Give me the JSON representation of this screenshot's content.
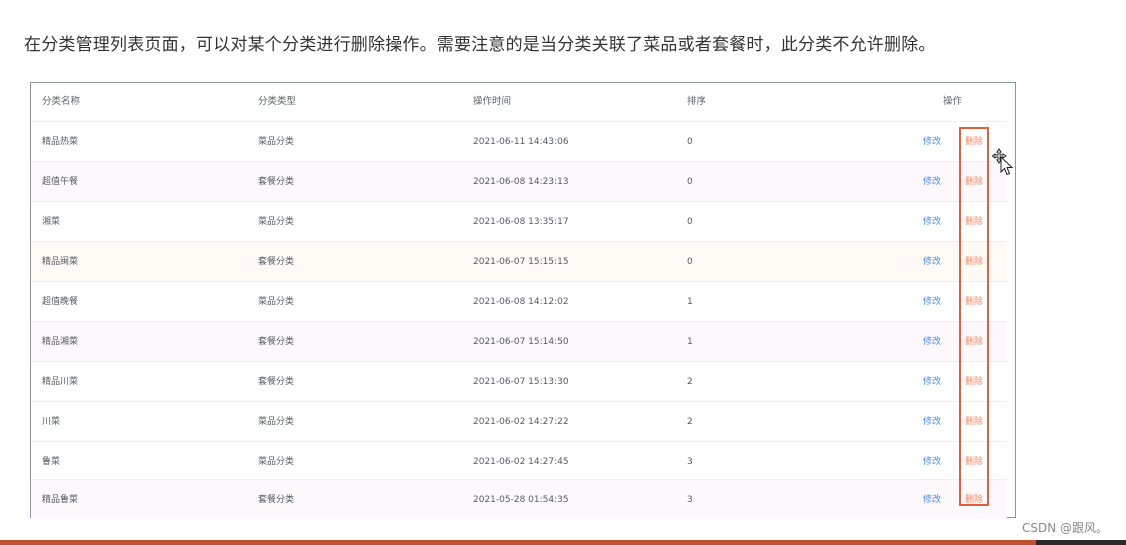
{
  "heading": "在分类管理列表页面，可以对某个分类进行删除操作。需要注意的是当分类关联了菜品或者套餐时，此分类不允许删除。",
  "table": {
    "headers": {
      "name": "分类名称",
      "type": "分类类型",
      "time": "操作时间",
      "sort": "排序",
      "ops": "操作"
    },
    "rows": [
      {
        "name": "精品热菜",
        "type": "菜品分类",
        "time": "2021-06-11 14:43:06",
        "sort": "0",
        "edit": "修改",
        "del": "删除"
      },
      {
        "name": "超值午餐",
        "type": "套餐分类",
        "time": "2021-06-08 14:23:13",
        "sort": "0",
        "edit": "修改",
        "del": "删除"
      },
      {
        "name": "湘菜",
        "type": "菜品分类",
        "time": "2021-06-08 13:35:17",
        "sort": "0",
        "edit": "修改",
        "del": "删除"
      },
      {
        "name": "精品闽菜",
        "type": "套餐分类",
        "time": "2021-06-07 15:15:15",
        "sort": "0",
        "edit": "修改",
        "del": "删除"
      },
      {
        "name": "超值晚餐",
        "type": "菜品分类",
        "time": "2021-06-08 14:12:02",
        "sort": "1",
        "edit": "修改",
        "del": "删除"
      },
      {
        "name": "精品湘菜",
        "type": "套餐分类",
        "time": "2021-06-07 15:14:50",
        "sort": "1",
        "edit": "修改",
        "del": "删除"
      },
      {
        "name": "精品川菜",
        "type": "套餐分类",
        "time": "2021-06-07 15:13:30",
        "sort": "2",
        "edit": "修改",
        "del": "删除"
      },
      {
        "name": "川菜",
        "type": "菜品分类",
        "time": "2021-06-02 14:27:22",
        "sort": "2",
        "edit": "修改",
        "del": "删除"
      },
      {
        "name": "鲁菜",
        "type": "菜品分类",
        "time": "2021-06-02 14:27:45",
        "sort": "3",
        "edit": "修改",
        "del": "删除"
      },
      {
        "name": "精品鲁菜",
        "type": "套餐分类",
        "time": "2021-05-28 01:54:35",
        "sort": "3",
        "edit": "修改",
        "del": "删除"
      }
    ]
  },
  "colors": {
    "edit_link": "#4a90d9",
    "delete_link": "#f08a6b",
    "highlight": "#e0603e"
  },
  "icons": {
    "cursor": "move-cursor-icon"
  },
  "watermark": "CSDN @跟风。"
}
